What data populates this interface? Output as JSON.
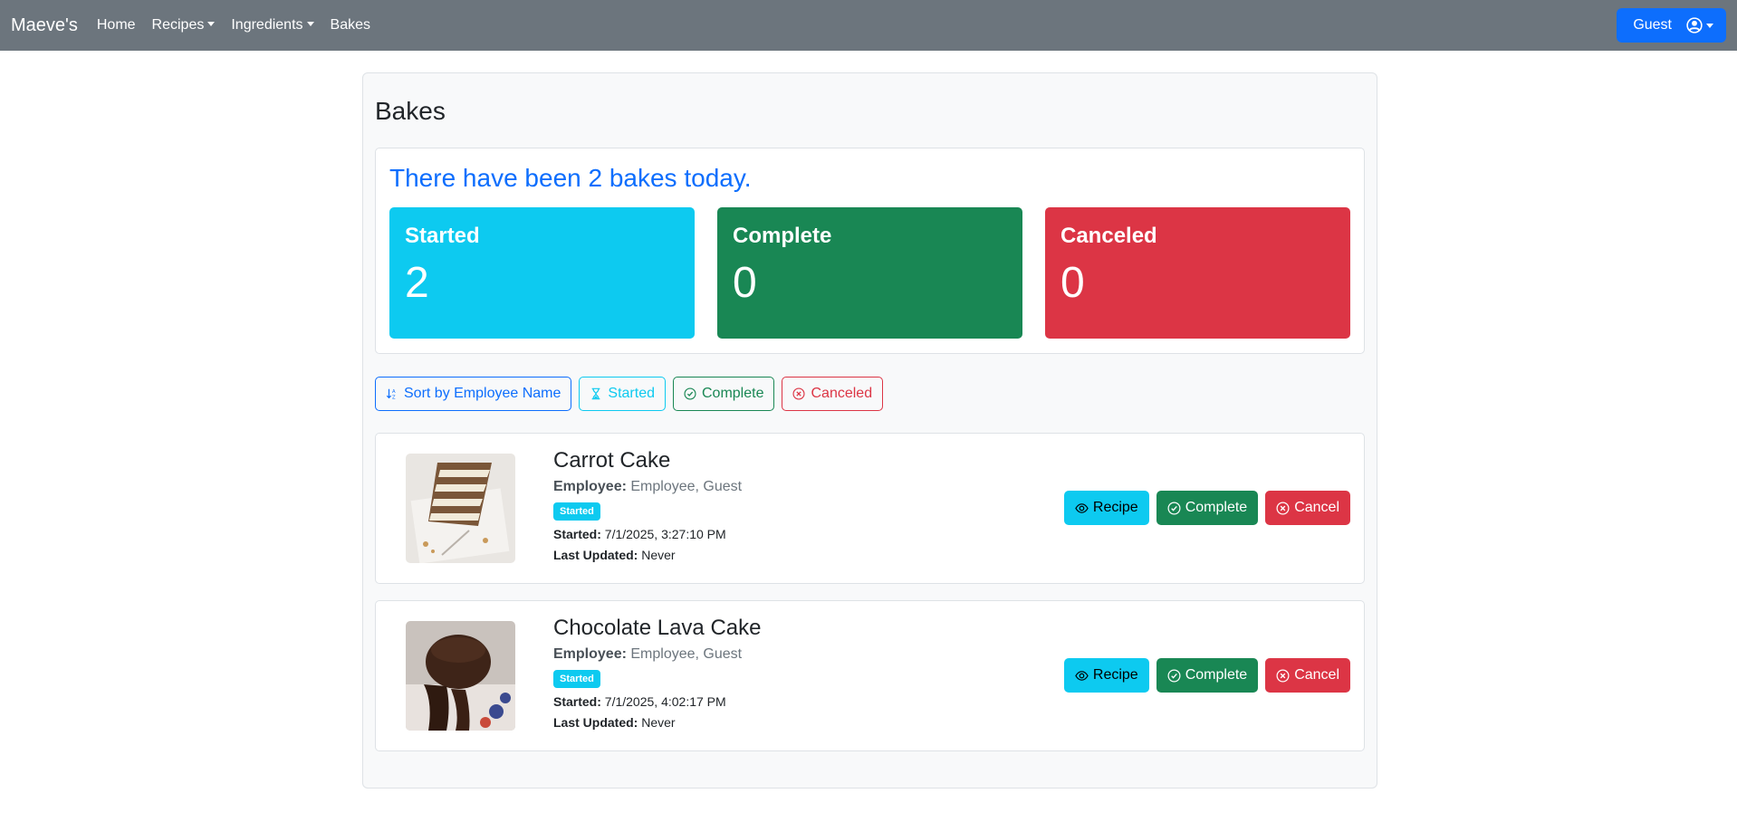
{
  "navbar": {
    "brand": "Maeve's",
    "items": [
      {
        "label": "Home",
        "dropdown": false
      },
      {
        "label": "Recipes",
        "dropdown": true
      },
      {
        "label": "Ingredients",
        "dropdown": true
      },
      {
        "label": "Bakes",
        "dropdown": false
      }
    ],
    "user_label": "Guest"
  },
  "page": {
    "title": "Bakes",
    "summary_title": "There have been 2 bakes today.",
    "stats": [
      {
        "label": "Started",
        "value": "2",
        "color": "#0dcaf0"
      },
      {
        "label": "Complete",
        "value": "0",
        "color": "#198754"
      },
      {
        "label": "Canceled",
        "value": "0",
        "color": "#dc3545"
      }
    ],
    "filters": [
      {
        "label": "Sort by Employee Name",
        "icon": "sort-icon",
        "color": "#0d6efd"
      },
      {
        "label": "Started",
        "icon": "hourglass-icon",
        "color": "#0dcaf0"
      },
      {
        "label": "Complete",
        "icon": "check-circle-icon",
        "color": "#198754"
      },
      {
        "label": "Canceled",
        "icon": "x-circle-icon",
        "color": "#dc3545"
      }
    ]
  },
  "bakes": [
    {
      "name": "Carrot Cake",
      "employee_label": "Employee:",
      "employee": "Employee, Guest",
      "status": "Started",
      "started_label": "Started:",
      "started": "7/1/2025, 3:27:10 PM",
      "updated_label": "Last Updated:",
      "updated": "Never",
      "image": "carrot-cake-photo"
    },
    {
      "name": "Chocolate Lava Cake",
      "employee_label": "Employee:",
      "employee": "Employee, Guest",
      "status": "Started",
      "started_label": "Started:",
      "started": "7/1/2025, 4:02:17 PM",
      "updated_label": "Last Updated:",
      "updated": "Never",
      "image": "chocolate-lava-cake-photo"
    }
  ],
  "actions": {
    "recipe": "Recipe",
    "complete": "Complete",
    "cancel": "Cancel"
  }
}
